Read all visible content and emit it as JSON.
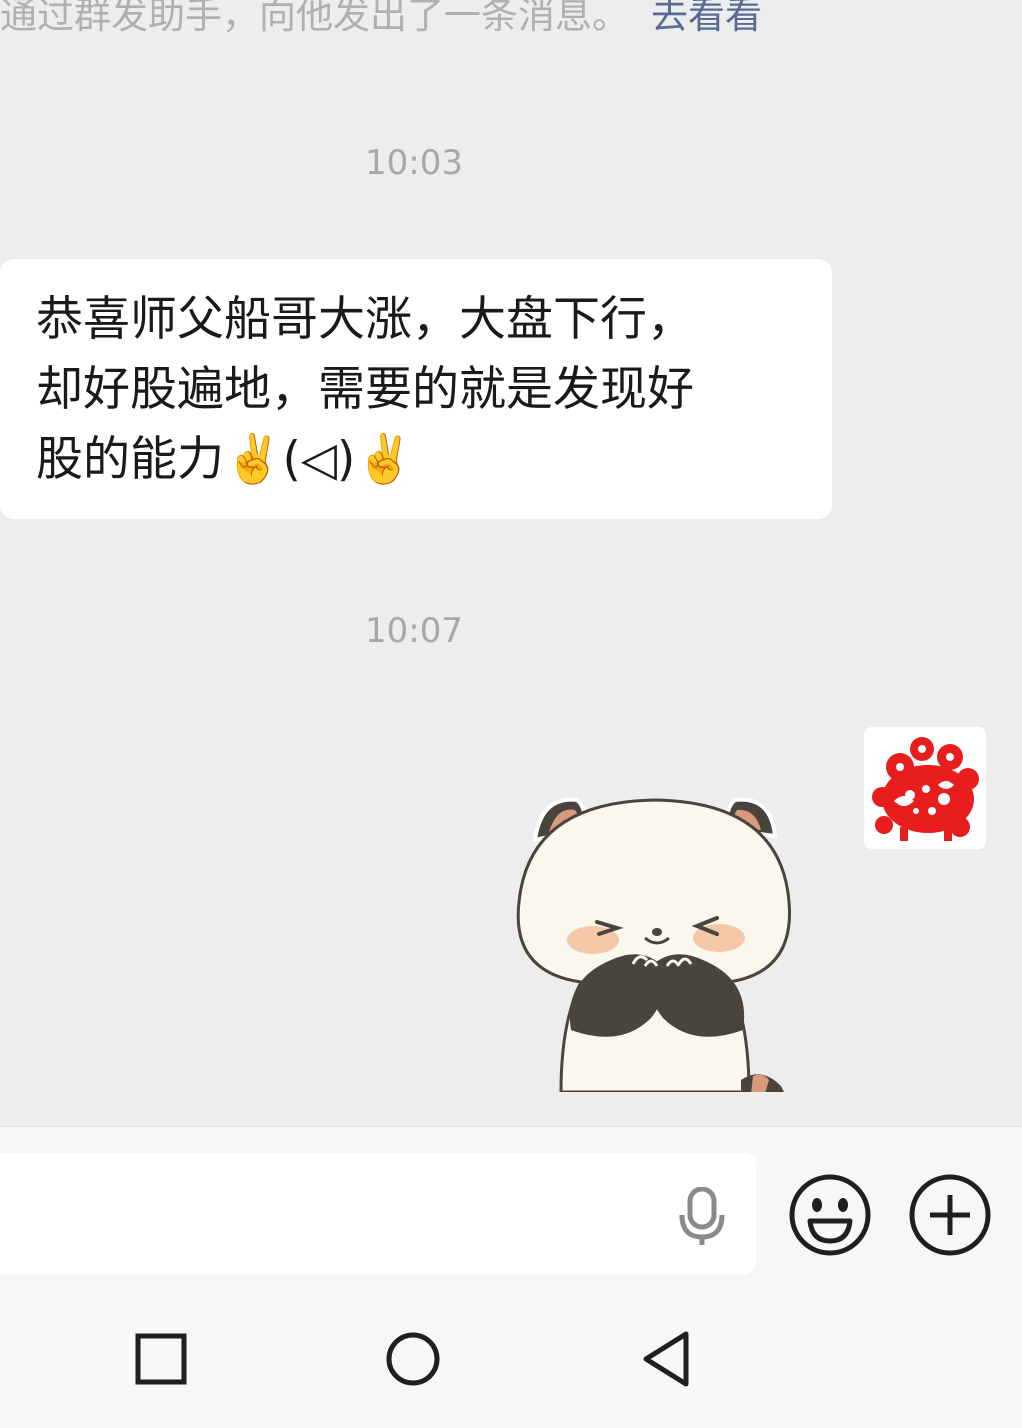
{
  "system_notice": {
    "text": "通过群发助手，向他发出了一条消息。",
    "link_label": "去看看"
  },
  "messages": [
    {
      "timestamp": "10:03"
    },
    {
      "text": "恭喜师父船哥大涨，大盘下行，\n却好股遍地，需要的就是发现好\n股的能力✌️(◁)✌️"
    },
    {
      "timestamp": "10:07"
    }
  ],
  "icons": {
    "mic": "microphone-icon",
    "emoji": "emoji-face-icon",
    "more": "plus-circle-icon",
    "nav_recent": "square-icon",
    "nav_home": "circle-icon",
    "nav_back": "triangle-back-icon"
  },
  "colors": {
    "chat_background": "#ededed",
    "link": "#576b95",
    "bubble_incoming": "#ffffff",
    "timestamp_text": "#a8a8a8"
  }
}
